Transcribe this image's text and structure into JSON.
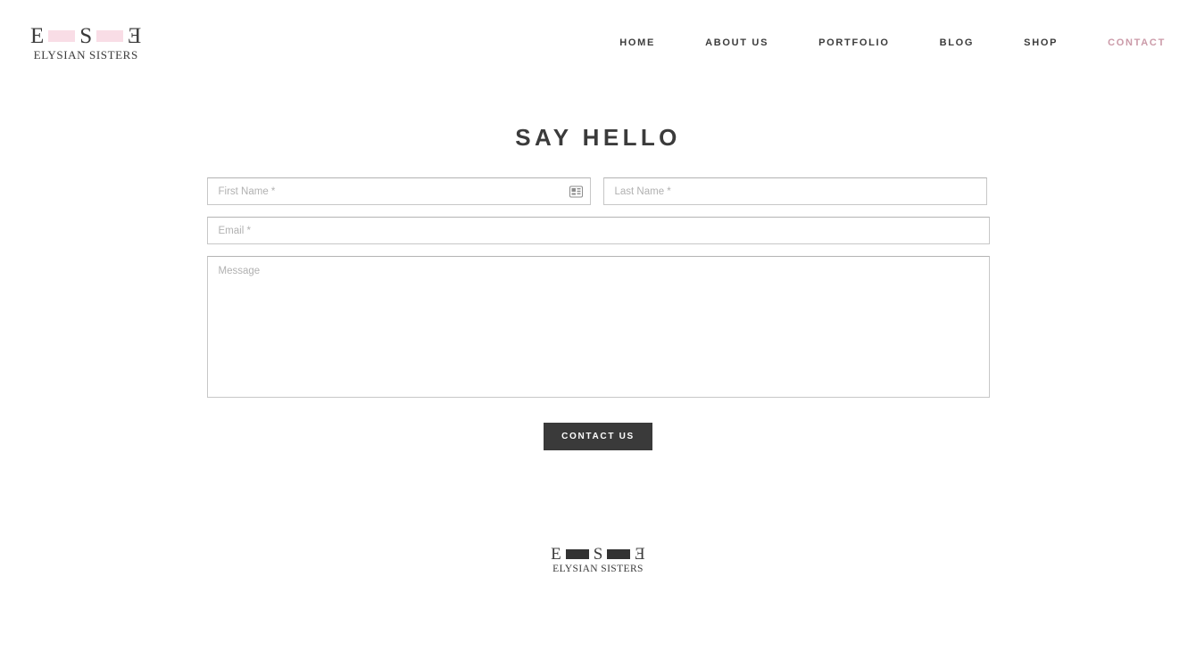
{
  "brand": {
    "logo_letter_left": "E",
    "logo_letter_mid": "S",
    "logo_letter_right": "E",
    "wordmark": "ELYSIAN SISTERS",
    "logo_bar_color_header": "#f9dde6",
    "logo_bar_color_footer": "#333333"
  },
  "nav": {
    "items": [
      {
        "label": "HOME",
        "active": false
      },
      {
        "label": "ABOUT US",
        "active": false
      },
      {
        "label": "PORTFOLIO",
        "active": false
      },
      {
        "label": "BLOG",
        "active": false
      },
      {
        "label": "SHOP",
        "active": false
      },
      {
        "label": "CONTACT",
        "active": true
      }
    ],
    "active_color": "#cb9aa8",
    "default_color": "#3c3c3c"
  },
  "main": {
    "heading": "SAY HELLO",
    "form": {
      "first_name": {
        "placeholder": "First Name *",
        "value": ""
      },
      "last_name": {
        "placeholder": "Last Name *",
        "value": ""
      },
      "email": {
        "placeholder": "Email *",
        "value": ""
      },
      "message": {
        "placeholder": "Message",
        "value": ""
      },
      "autofill_icon": "contact-card-icon",
      "submit_label": "CONTACT US",
      "submit_color": "#3a3a3a"
    }
  },
  "footer": {
    "logo_letter_left": "E",
    "logo_letter_mid": "S",
    "logo_letter_right": "E",
    "wordmark": "ELYSIAN SISTERS"
  }
}
